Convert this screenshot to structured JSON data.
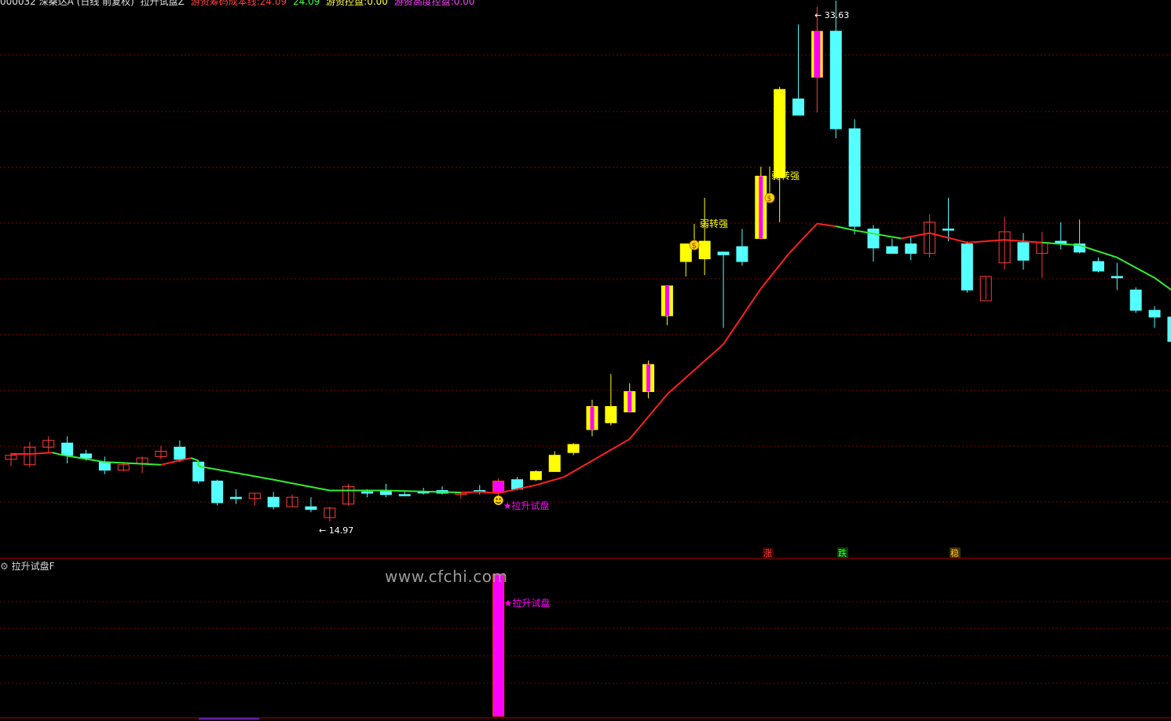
{
  "header": {
    "stock": "000032 深桑达A (日线 前复权)",
    "indicator": "拉升试盘Z",
    "cost_label": "游资筹码成本线:",
    "cost_v1": "24.09",
    "cost_v2": "24.09",
    "control_label": "游资控盘:",
    "control_value": "0.00",
    "high_label": "游资高度控盘:",
    "high_value": "0.00"
  },
  "sub_panel": {
    "title": "拉升试盘F",
    "label": "★拉升试盘"
  },
  "watermark": "www.cfchi.com",
  "annotations": {
    "high_label": "33.63",
    "low_label": "14.97",
    "signal_main": "★拉升试盘",
    "weak_to_strong_1": "弱转强",
    "weak_to_strong_2": "弱转强",
    "zhang": "涨",
    "die": "跌",
    "wen": "稳"
  },
  "colors": {
    "up": "#ff3b3b",
    "down": "#54ffff",
    "yellow": "#ffff00",
    "magenta": "#ff00ff",
    "ma_red": "#ff2020",
    "ma_green": "#33ee33",
    "grid": "#7a0000"
  },
  "chart_data": {
    "type": "candlestick",
    "y_range": [
      14.0,
      35.5
    ],
    "candles": [
      {
        "o": 16.7,
        "h": 16.95,
        "l": 16.45,
        "c": 16.85,
        "k": "up"
      },
      {
        "o": 16.5,
        "h": 17.35,
        "l": 16.4,
        "c": 17.15,
        "k": "up"
      },
      {
        "o": 17.15,
        "h": 17.55,
        "l": 16.95,
        "c": 17.4,
        "k": "up"
      },
      {
        "o": 17.3,
        "h": 17.55,
        "l": 16.55,
        "c": 16.85,
        "k": "down"
      },
      {
        "o": 16.9,
        "h": 17.05,
        "l": 16.65,
        "c": 16.75,
        "k": "down"
      },
      {
        "o": 16.6,
        "h": 16.8,
        "l": 16.15,
        "c": 16.3,
        "k": "down"
      },
      {
        "o": 16.3,
        "h": 16.6,
        "l": 16.25,
        "c": 16.5,
        "k": "up"
      },
      {
        "o": 16.55,
        "h": 16.8,
        "l": 16.2,
        "c": 16.75,
        "k": "up"
      },
      {
        "o": 16.8,
        "h": 17.2,
        "l": 16.7,
        "c": 17.0,
        "k": "up"
      },
      {
        "o": 17.15,
        "h": 17.4,
        "l": 16.6,
        "c": 16.7,
        "k": "down"
      },
      {
        "o": 16.6,
        "h": 16.65,
        "l": 15.8,
        "c": 15.9,
        "k": "down"
      },
      {
        "o": 15.9,
        "h": 15.95,
        "l": 15.0,
        "c": 15.1,
        "k": "down"
      },
      {
        "o": 15.3,
        "h": 15.6,
        "l": 15.05,
        "c": 15.25,
        "k": "down"
      },
      {
        "o": 15.25,
        "h": 15.45,
        "l": 15.0,
        "c": 15.45,
        "k": "up"
      },
      {
        "o": 15.3,
        "h": 15.5,
        "l": 14.85,
        "c": 14.95,
        "k": "down"
      },
      {
        "o": 14.95,
        "h": 15.4,
        "l": 14.95,
        "c": 15.3,
        "k": "up"
      },
      {
        "o": 14.95,
        "h": 15.3,
        "l": 14.75,
        "c": 14.85,
        "k": "down"
      },
      {
        "o": 14.55,
        "h": 14.95,
        "l": 14.4,
        "c": 14.9,
        "k": "up"
      },
      {
        "o": 15.05,
        "h": 15.8,
        "l": 15.0,
        "c": 15.7,
        "k": "up"
      },
      {
        "o": 15.5,
        "h": 15.6,
        "l": 15.3,
        "c": 15.45,
        "k": "down"
      },
      {
        "o": 15.55,
        "h": 15.8,
        "l": 15.3,
        "c": 15.4,
        "k": "down"
      },
      {
        "o": 15.4,
        "h": 15.5,
        "l": 15.35,
        "c": 15.4,
        "k": "down"
      },
      {
        "o": 15.5,
        "h": 15.65,
        "l": 15.4,
        "c": 15.5,
        "k": "down"
      },
      {
        "o": 15.55,
        "h": 15.7,
        "l": 15.4,
        "c": 15.45,
        "k": "down"
      },
      {
        "o": 15.4,
        "h": 15.45,
        "l": 15.25,
        "c": 15.45,
        "k": "up"
      },
      {
        "o": 15.55,
        "h": 15.75,
        "l": 15.4,
        "c": 15.5,
        "k": "down"
      },
      {
        "o": 15.5,
        "h": 16.0,
        "l": 15.35,
        "c": 15.9,
        "k": "magenta"
      },
      {
        "o": 15.6,
        "h": 16.05,
        "l": 15.55,
        "c": 15.95,
        "k": "down"
      },
      {
        "o": 15.95,
        "h": 16.3,
        "l": 15.9,
        "c": 16.25,
        "k": "yellow"
      },
      {
        "o": 16.25,
        "h": 17.0,
        "l": 16.25,
        "c": 16.85,
        "k": "yellow"
      },
      {
        "o": 16.95,
        "h": 17.3,
        "l": 16.85,
        "c": 17.25,
        "k": "yellow"
      },
      {
        "o": 17.8,
        "h": 18.9,
        "l": 17.55,
        "c": 18.65,
        "k": "yellowm"
      },
      {
        "o": 18.05,
        "h": 19.85,
        "l": 17.95,
        "c": 18.65,
        "k": "yellow"
      },
      {
        "o": 18.45,
        "h": 19.5,
        "l": 18.45,
        "c": 19.2,
        "k": "yellowm"
      },
      {
        "o": 19.2,
        "h": 20.35,
        "l": 18.95,
        "c": 20.2,
        "k": "yellowm"
      },
      {
        "o": 22.0,
        "h": 23.1,
        "l": 21.65,
        "c": 23.1,
        "k": "yellowm"
      },
      {
        "o": 24.0,
        "h": 24.55,
        "l": 23.45,
        "c": 24.65,
        "k": "yellow"
      },
      {
        "o": 24.1,
        "h": 26.35,
        "l": 23.5,
        "c": 24.75,
        "k": "yellow"
      },
      {
        "o": 24.25,
        "h": 24.35,
        "l": 21.55,
        "c": 24.35,
        "k": "down"
      },
      {
        "o": 24.0,
        "h": 25.2,
        "l": 23.85,
        "c": 24.55,
        "k": "down"
      },
      {
        "o": 24.85,
        "h": 27.5,
        "l": 24.95,
        "c": 27.15,
        "k": "yellowm"
      },
      {
        "o": 27.1,
        "h": 30.45,
        "l": 25.45,
        "c": 30.35,
        "k": "yellow"
      },
      {
        "o": 30.0,
        "h": 32.75,
        "l": 29.45,
        "c": 29.4,
        "k": "down"
      },
      {
        "o": 30.8,
        "h": 33.4,
        "l": 29.5,
        "c": 32.5,
        "k": "magenta"
      },
      {
        "o": 32.5,
        "h": 33.63,
        "l": 28.55,
        "c": 28.9,
        "k": "down"
      },
      {
        "o": 28.9,
        "h": 29.25,
        "l": 25.0,
        "c": 25.3,
        "k": "down"
      },
      {
        "o": 25.2,
        "h": 25.35,
        "l": 24.0,
        "c": 24.5,
        "k": "down"
      },
      {
        "o": 24.55,
        "h": 24.85,
        "l": 24.3,
        "c": 24.3,
        "k": "down"
      },
      {
        "o": 24.65,
        "h": 24.95,
        "l": 24.05,
        "c": 24.3,
        "k": "down"
      },
      {
        "o": 24.3,
        "h": 25.75,
        "l": 24.15,
        "c": 25.45,
        "k": "up"
      },
      {
        "o": 25.2,
        "h": 26.35,
        "l": 24.75,
        "c": 25.2,
        "k": "down"
      },
      {
        "o": 24.65,
        "h": 24.75,
        "l": 22.85,
        "c": 22.95,
        "k": "down"
      },
      {
        "o": 22.55,
        "h": 23.45,
        "l": 22.6,
        "c": 23.45,
        "k": "up"
      },
      {
        "o": 23.95,
        "h": 25.65,
        "l": 23.7,
        "c": 25.1,
        "k": "up"
      },
      {
        "o": 24.7,
        "h": 25.05,
        "l": 23.7,
        "c": 24.05,
        "k": "down"
      },
      {
        "o": 24.3,
        "h": 25.1,
        "l": 23.4,
        "c": 24.7,
        "k": "up"
      },
      {
        "o": 24.75,
        "h": 25.45,
        "l": 24.45,
        "c": 24.65,
        "k": "down"
      },
      {
        "o": 24.65,
        "h": 25.55,
        "l": 24.3,
        "c": 24.35,
        "k": "down"
      },
      {
        "o": 24.0,
        "h": 24.15,
        "l": 23.6,
        "c": 23.65,
        "k": "down"
      },
      {
        "o": 23.45,
        "h": 23.95,
        "l": 22.95,
        "c": 23.4,
        "k": "down"
      },
      {
        "o": 22.95,
        "h": 23.05,
        "l": 22.1,
        "c": 22.2,
        "k": "down"
      },
      {
        "o": 22.2,
        "h": 22.35,
        "l": 21.55,
        "c": 21.95,
        "k": "down"
      },
      {
        "o": 21.95,
        "h": 21.95,
        "l": 20.9,
        "c": 21.05,
        "k": "down"
      }
    ],
    "ma": [
      {
        "x": 0,
        "v": 16.9,
        "c": "red"
      },
      {
        "x": 9.6,
        "v": 16.75,
        "c": "red"
      },
      {
        "x": 10.0,
        "v": 16.65,
        "c": "green"
      },
      {
        "x": 1.0,
        "v": 16.9,
        "c": "red"
      },
      {
        "x": 2.2,
        "v": 16.95,
        "c": "red"
      },
      {
        "x": 2.8,
        "v": 16.85,
        "c": "green"
      },
      {
        "x": 5.0,
        "v": 16.6,
        "c": "green"
      },
      {
        "x": 8.0,
        "v": 16.5,
        "c": "green"
      },
      {
        "x": 10.0,
        "v": 16.45,
        "c": "green"
      },
      {
        "x": 14.0,
        "v": 15.95,
        "c": "green"
      },
      {
        "x": 17.0,
        "v": 15.55,
        "c": "green"
      },
      {
        "x": 20.0,
        "v": 15.55,
        "c": "green"
      },
      {
        "x": 24.0,
        "v": 15.48,
        "c": "green"
      },
      {
        "x": 25.0,
        "v": 15.5,
        "c": "red"
      },
      {
        "x": 26.0,
        "v": 15.45,
        "c": "red"
      },
      {
        "x": 28.0,
        "v": 15.75,
        "c": "red"
      },
      {
        "x": 29.5,
        "v": 16.05,
        "c": "red"
      },
      {
        "x": 31.0,
        "v": 16.65,
        "c": "red"
      },
      {
        "x": 33.0,
        "v": 17.45,
        "c": "red"
      },
      {
        "x": 35.0,
        "v": 19.1,
        "c": "red"
      },
      {
        "x": 38.0,
        "v": 20.95,
        "c": "red"
      },
      {
        "x": 40.0,
        "v": 23.0,
        "c": "red"
      },
      {
        "x": 41.5,
        "v": 24.3,
        "c": "red"
      },
      {
        "x": 43.0,
        "v": 25.4,
        "c": "red"
      },
      {
        "x": 44.0,
        "v": 25.3,
        "c": "red"
      },
      {
        "x": 45.0,
        "v": 25.15,
        "c": "green"
      },
      {
        "x": 47.5,
        "v": 24.85,
        "c": "green"
      },
      {
        "x": 49.0,
        "v": 25.05,
        "c": "red"
      },
      {
        "x": 51.0,
        "v": 24.7,
        "c": "red"
      },
      {
        "x": 53.0,
        "v": 24.8,
        "c": "red"
      },
      {
        "x": 55.0,
        "v": 24.7,
        "c": "red"
      },
      {
        "x": 57.0,
        "v": 24.6,
        "c": "green"
      },
      {
        "x": 59.0,
        "v": 24.15,
        "c": "green"
      },
      {
        "x": 61.0,
        "v": 23.4,
        "c": "green"
      },
      {
        "x": 62.3,
        "v": 22.75,
        "c": "green"
      }
    ],
    "sub_bar": {
      "x": 26,
      "value": 1,
      "color": "#ff00ff"
    }
  }
}
